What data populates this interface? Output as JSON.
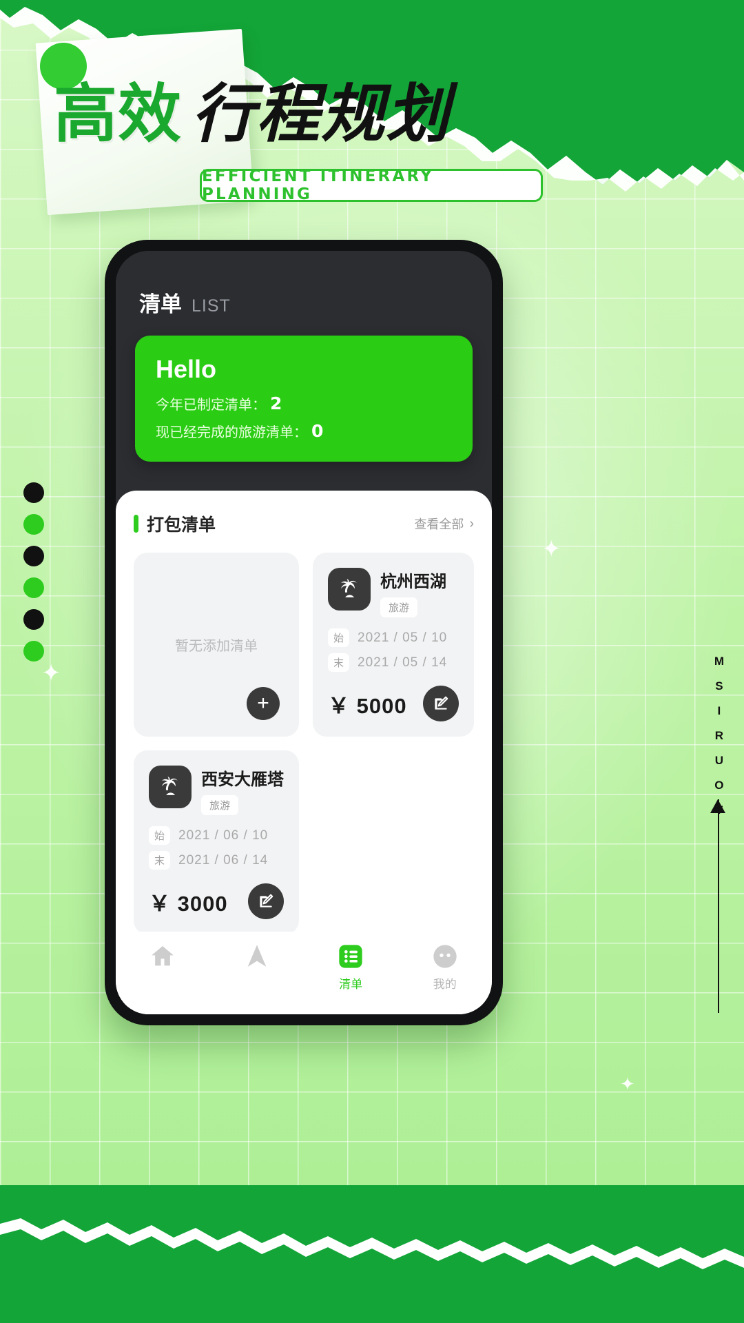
{
  "poster": {
    "headline_green": "高效",
    "headline_black": "行程规划",
    "subtitle_en": "EFFICIENT  ITINERARY  PLANNING",
    "vertical_text": "TOURISM",
    "accent_green": "#2ecc1e",
    "band_green": "#13a538",
    "dots": [
      "#111111",
      "#2ecc1e",
      "#111111",
      "#2ecc1e",
      "#111111",
      "#2ecc1e"
    ]
  },
  "app": {
    "header": {
      "title": "清单",
      "title_en": "LIST"
    },
    "hello_card": {
      "greeting": "Hello",
      "stats": [
        {
          "label": "今年已制定清单：",
          "value": "2"
        },
        {
          "label": "现已经完成的旅游清单：",
          "value": "0"
        }
      ]
    },
    "section": {
      "title": "打包清单",
      "more_label": "查看全部",
      "chevron": "›"
    },
    "empty_card": {
      "text": "暂无添加清单",
      "add_label": "+"
    },
    "trips": [
      {
        "name": "杭州西湖",
        "tag": "旅游",
        "start_label": "始",
        "start_date": "2021 / 05 / 10",
        "end_label": "末",
        "end_date": "2021 / 05 / 14",
        "price": "￥ 5000",
        "icon": "palm-tree-icon"
      },
      {
        "name": "西安大雁塔",
        "tag": "旅游",
        "start_label": "始",
        "start_date": "2021 / 06 / 10",
        "end_label": "末",
        "end_date": "2021 / 06 / 14",
        "price": "￥ 3000",
        "icon": "palm-tree-icon"
      }
    ],
    "tabs": [
      {
        "label": "",
        "icon": "home-icon",
        "active": false
      },
      {
        "label": "",
        "icon": "navigation-arrow-icon",
        "active": false
      },
      {
        "label": "清单",
        "icon": "list-icon",
        "active": true
      },
      {
        "label": "我的",
        "icon": "profile-icon",
        "active": false
      }
    ]
  }
}
